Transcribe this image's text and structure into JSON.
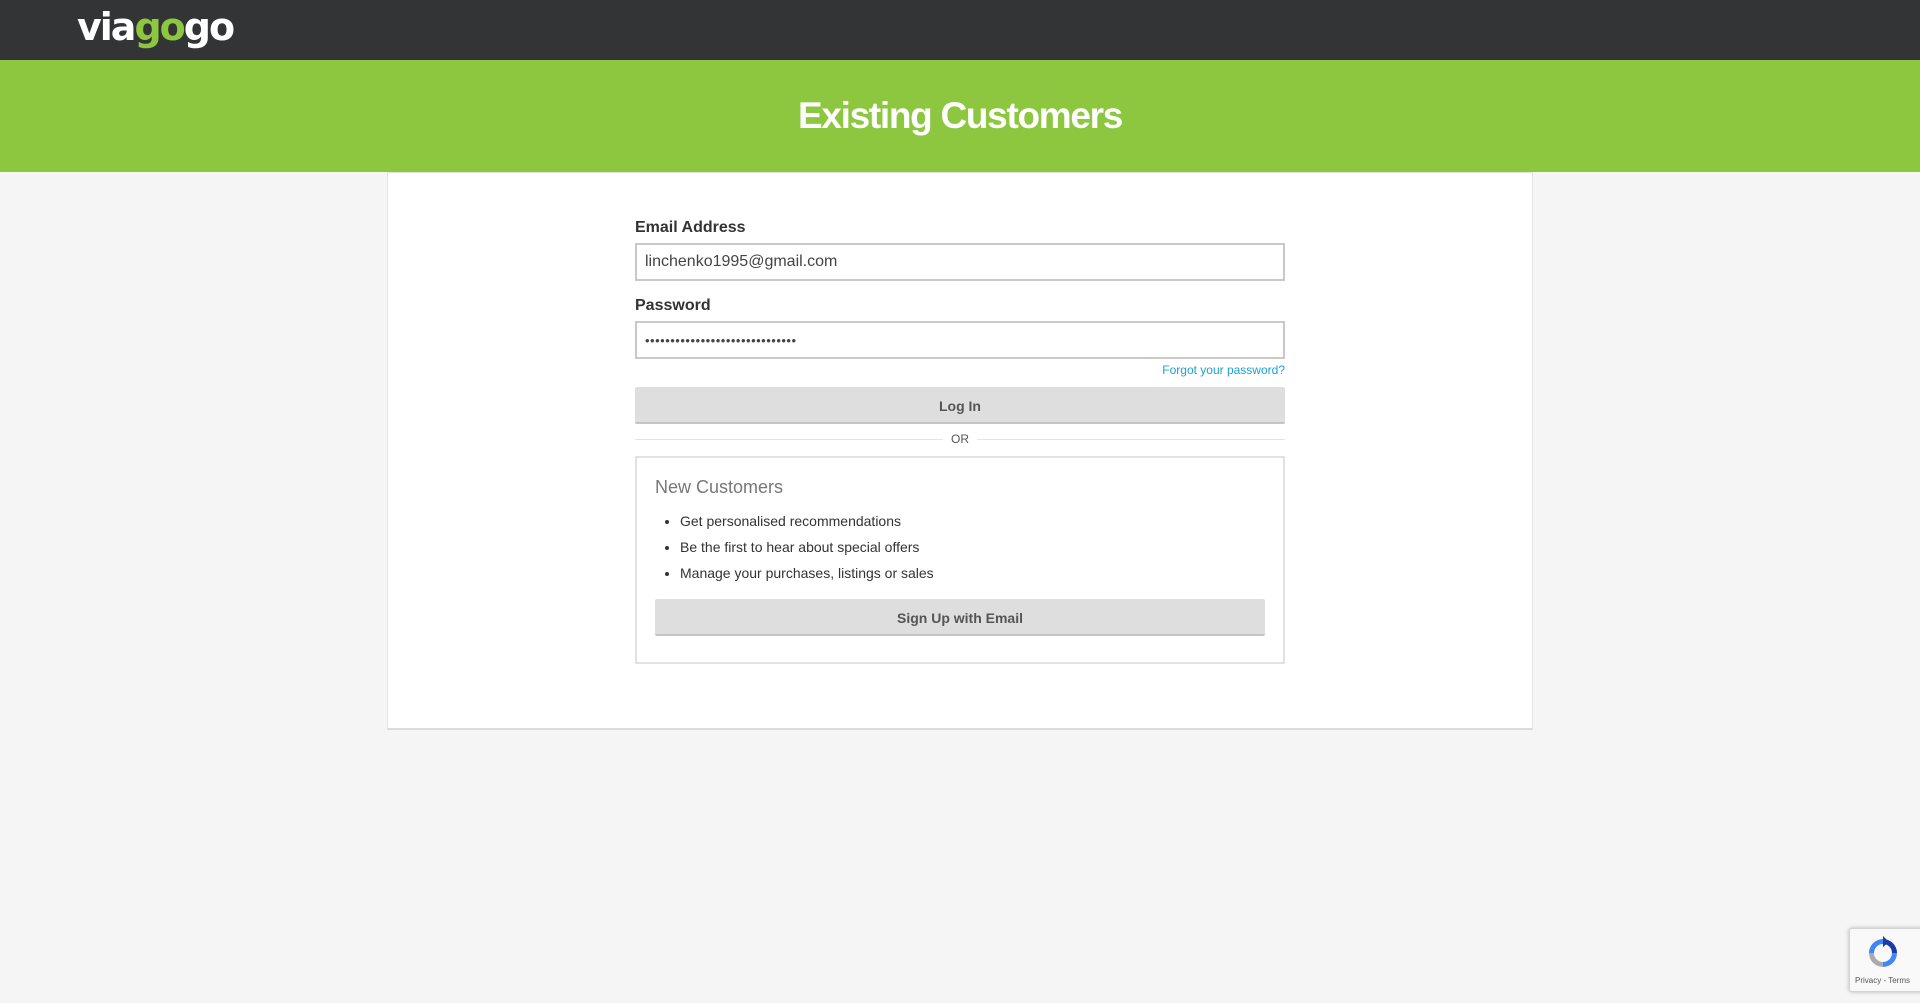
{
  "header": {
    "logo": {
      "part1": "via",
      "part2": "go",
      "part3": "go"
    }
  },
  "hero": {
    "title": "Existing Customers"
  },
  "login": {
    "email_label": "Email Address",
    "email_value": "linchenko1995@gmail.com",
    "password_label": "Password",
    "password_value": "••••••••••••••••••••••••••••••",
    "forgot_label": "Forgot your password?",
    "login_button": "Log In"
  },
  "divider": {
    "label": "OR"
  },
  "new_customers": {
    "title": "New Customers",
    "benefits": [
      "Get personalised recommendations",
      "Be the first to hear about special offers",
      "Manage your purchases, listings or sales"
    ],
    "signup_button": "Sign Up with Email"
  },
  "recaptcha": {
    "privacy": "Privacy",
    "separator": " - ",
    "terms": "Terms"
  },
  "colors": {
    "header_bg": "#333435",
    "brand_green": "#8dc63f",
    "link_blue": "#1ba2d6",
    "page_bg": "#f5f5f5"
  }
}
